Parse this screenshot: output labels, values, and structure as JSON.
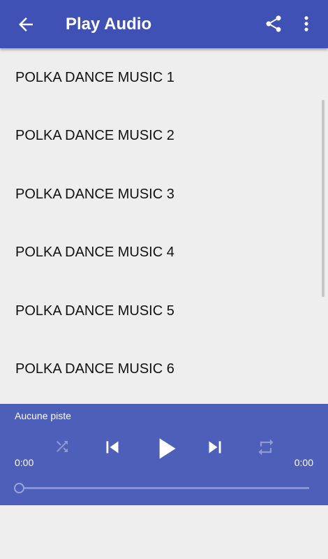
{
  "appbar": {
    "title": "Play Audio",
    "icons": {
      "back": "arrow-back-icon",
      "share": "share-icon",
      "more": "more-vert-icon"
    }
  },
  "tracks": [
    "POLKA DANCE MUSIC 1",
    "POLKA DANCE MUSIC 2",
    "POLKA DANCE MUSIC 3",
    "POLKA DANCE MUSIC 4",
    "POLKA DANCE MUSIC 5",
    "POLKA DANCE MUSIC 6"
  ],
  "player": {
    "status": "Aucune piste",
    "time_elapsed": "0:00",
    "time_total": "0:00",
    "progress": 0,
    "icons": {
      "shuffle": "shuffle-icon",
      "previous": "skip-previous-icon",
      "play": "play-icon",
      "next": "skip-next-icon",
      "repeat": "repeat-icon"
    }
  },
  "colors": {
    "primary": "#3f51b5",
    "player_bg": "#4e5fb9",
    "background": "#eeeeee"
  }
}
